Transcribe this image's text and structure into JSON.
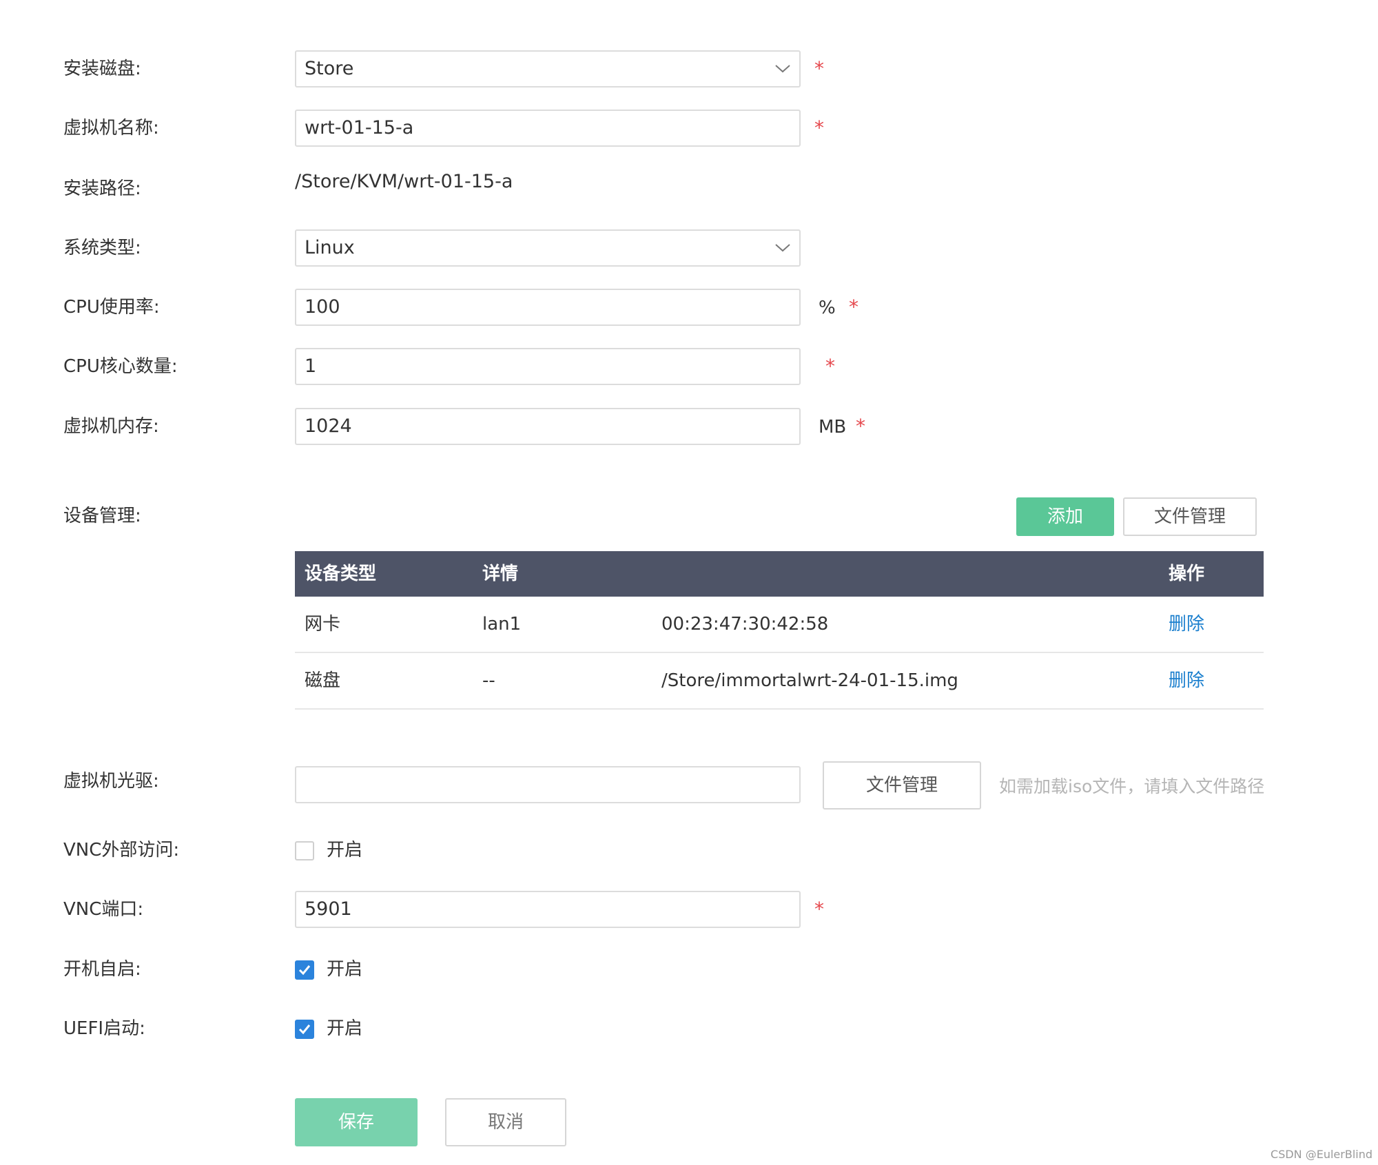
{
  "form": {
    "install_disk": {
      "label": "安装磁盘:",
      "value": "Store",
      "required": "*"
    },
    "vm_name": {
      "label": "虚拟机名称:",
      "value": "wrt-01-15-a",
      "required": "*"
    },
    "install_path": {
      "label": "安装路径:",
      "value": "/Store/KVM/wrt-01-15-a"
    },
    "os_type": {
      "label": "系统类型:",
      "value": "Linux"
    },
    "cpu_usage": {
      "label": "CPU使用率:",
      "value": "100",
      "unit": "%",
      "required": "*"
    },
    "cpu_cores": {
      "label": "CPU核心数量:",
      "value": "1",
      "required": "*"
    },
    "vm_memory": {
      "label": "虚拟机内存:",
      "value": "1024",
      "unit": "MB",
      "required": "*"
    },
    "devices": {
      "label": "设备管理:",
      "add_button": "添加",
      "file_manage_button": "文件管理",
      "headers": {
        "type": "设备类型",
        "detail": "详情",
        "action": "操作"
      },
      "rows": [
        {
          "type": "网卡",
          "detail": "lan1",
          "info": "00:23:47:30:42:58",
          "action": "删除"
        },
        {
          "type": "磁盘",
          "detail": "--",
          "info": "/Store/immortalwrt-24-01-15.img",
          "action": "删除"
        }
      ]
    },
    "cdrom": {
      "label": "虚拟机光驱:",
      "value": "",
      "file_manage_button": "文件管理",
      "hint": "如需加载iso文件，请填入文件路径"
    },
    "vnc_access": {
      "label": "VNC外部访问:",
      "option": "开启",
      "checked": false
    },
    "vnc_port": {
      "label": "VNC端口:",
      "value": "5901",
      "required": "*"
    },
    "autostart": {
      "label": "开机自启:",
      "option": "开启",
      "checked": true
    },
    "uefi": {
      "label": "UEFI启动:",
      "option": "开启",
      "checked": true
    },
    "actions": {
      "save": "保存",
      "cancel": "取消"
    }
  },
  "watermark": "CSDN @EulerBlind",
  "colors": {
    "accent_green": "#5ac797",
    "table_header": "#4e5467",
    "link_blue": "#1b7fce",
    "required_red": "#e5484d",
    "checkbox_blue": "#2b83dc"
  }
}
